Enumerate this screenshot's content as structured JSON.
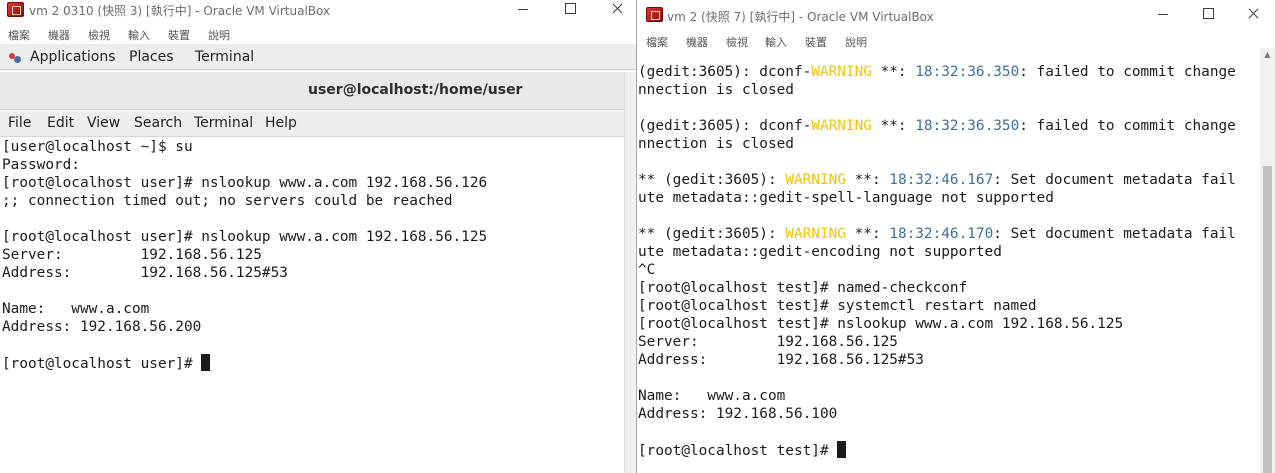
{
  "left_window": {
    "title": "vm 2 0310 (快照 3) [執行中] - Oracle VM VirtualBox",
    "vbox_menu": [
      "檔案",
      "機器",
      "檢視",
      "輸入",
      "裝置",
      "說明"
    ],
    "gnome_panel": {
      "applications": "Applications",
      "places": "Places",
      "terminal": "Terminal"
    },
    "terminal_title": "user@localhost:/home/user",
    "terminal_menu": [
      "File",
      "Edit",
      "View",
      "Search",
      "Terminal",
      "Help"
    ],
    "terminal_lines": [
      "[user@localhost ~]$ su",
      "Password:",
      "[root@localhost user]# nslookup www.a.com 192.168.56.126",
      ";; connection timed out; no servers could be reached",
      "",
      "[root@localhost user]# nslookup www.a.com 192.168.56.125",
      "Server:         192.168.56.125",
      "Address:        192.168.56.125#53",
      "",
      "Name:   www.a.com",
      "Address: 192.168.56.200",
      "",
      "[root@localhost user]# "
    ]
  },
  "right_window": {
    "title": "vm 2 (快照 7) [執行中] - Oracle VM VirtualBox",
    "vbox_menu": [
      "檔案",
      "機器",
      "檢視",
      "輸入",
      "裝置",
      "說明"
    ],
    "terminal_lines": [
      [
        {
          "t": "(gedit:3605): dconf-"
        },
        {
          "t": "WARNING",
          "c": "warn"
        },
        {
          "t": " **: "
        },
        {
          "t": "18:32:36.350",
          "c": "ts"
        },
        {
          "t": ": failed to commit change"
        }
      ],
      [
        {
          "t": "nnection is closed"
        }
      ],
      [
        {
          "t": ""
        }
      ],
      [
        {
          "t": "(gedit:3605): dconf-"
        },
        {
          "t": "WARNING",
          "c": "warn"
        },
        {
          "t": " **: "
        },
        {
          "t": "18:32:36.350",
          "c": "ts"
        },
        {
          "t": ": failed to commit change"
        }
      ],
      [
        {
          "t": "nnection is closed"
        }
      ],
      [
        {
          "t": ""
        }
      ],
      [
        {
          "t": "** (gedit:3605): "
        },
        {
          "t": "WARNING",
          "c": "warn"
        },
        {
          "t": " **: "
        },
        {
          "t": "18:32:46.167",
          "c": "ts"
        },
        {
          "t": ": Set document metadata fail"
        }
      ],
      [
        {
          "t": "ute metadata::gedit-spell-language not supported"
        }
      ],
      [
        {
          "t": ""
        }
      ],
      [
        {
          "t": "** (gedit:3605): "
        },
        {
          "t": "WARNING",
          "c": "warn"
        },
        {
          "t": " **: "
        },
        {
          "t": "18:32:46.170",
          "c": "ts"
        },
        {
          "t": ": Set document metadata fail"
        }
      ],
      [
        {
          "t": "ute metadata::gedit-encoding not supported"
        }
      ],
      [
        {
          "t": "^C"
        }
      ],
      [
        {
          "t": "[root@localhost test]# named-checkconf"
        }
      ],
      [
        {
          "t": "[root@localhost test]# systemctl restart named"
        }
      ],
      [
        {
          "t": "[root@localhost test]# nslookup www.a.com 192.168.56.125"
        }
      ],
      [
        {
          "t": "Server:         192.168.56.125"
        }
      ],
      [
        {
          "t": "Address:        192.168.56.125#53"
        }
      ],
      [
        {
          "t": ""
        }
      ],
      [
        {
          "t": "Name:   www.a.com"
        }
      ],
      [
        {
          "t": "Address: 192.168.56.100"
        }
      ],
      [
        {
          "t": ""
        }
      ],
      [
        {
          "t": "[root@localhost test]# "
        }
      ]
    ]
  },
  "icons": {
    "vbox_logo": "virtualbox-logo-icon",
    "minimize": "minimize-icon",
    "maximize": "maximize-icon",
    "close": "close-icon",
    "applications": "gnome-foot-icon",
    "cursor": "terminal-cursor"
  },
  "colors": {
    "warning": "#f1c40f",
    "timestamp": "#3e6f9a",
    "terminal_text": "#1b1b1b",
    "panel_bg": "#ededed"
  }
}
